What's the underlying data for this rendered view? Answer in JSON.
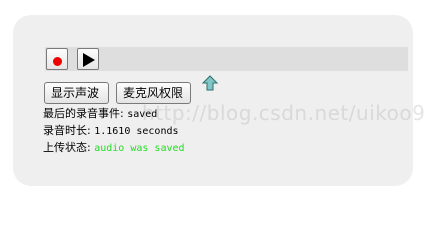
{
  "controls": {
    "record_button": "",
    "play_button": ""
  },
  "buttons": {
    "show_waveform": "显示声波",
    "mic_permission": "麦克风权限"
  },
  "status": {
    "last_event_label": "最后的录音事件:",
    "last_event_value": "saved",
    "duration_label": "录音时长:",
    "duration_value": "1.1610 seconds",
    "upload_label": "上传状态:",
    "upload_value": "audio was saved"
  },
  "watermark": "http://blog.csdn.net/uikoo9",
  "colors": {
    "panel": "#efefef",
    "track": "#dedede",
    "record_dot": "#ee0000",
    "upload_status": "#22dd22",
    "arrow": "#7fc7c7"
  },
  "icons": {
    "upload": "up-arrow-icon",
    "record": "record-dot-icon",
    "play": "play-icon"
  }
}
